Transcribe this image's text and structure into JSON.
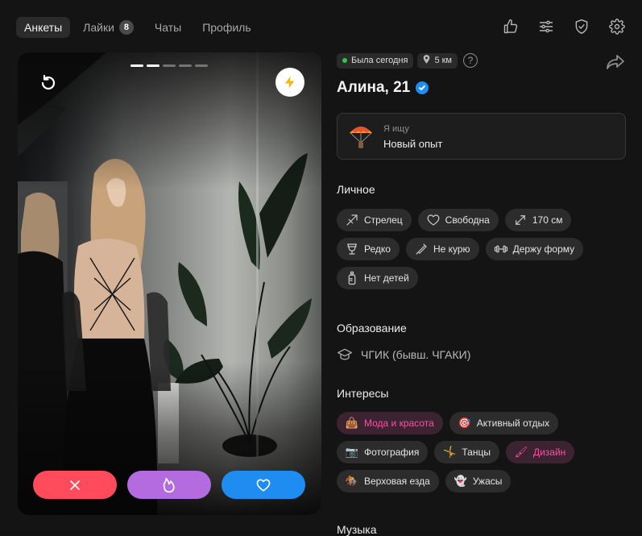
{
  "tabs": [
    {
      "label": "Анкеты",
      "active": true
    },
    {
      "label": "Лайки",
      "badge": "8"
    },
    {
      "label": "Чаты"
    },
    {
      "label": "Профиль"
    }
  ],
  "top_icons": [
    "thumbs-up-icon",
    "filters-icon",
    "shield-check-icon",
    "settings-icon"
  ],
  "photo": {
    "progress_total": 5,
    "progress_current": 2
  },
  "actions": {
    "dislike_color": "#ff4b5c",
    "super_color": "#b56be0",
    "like_color": "#1f8cf2"
  },
  "profile": {
    "status": "Была сегодня",
    "distance": "5 км",
    "help": "?",
    "name": "Алина, 21",
    "verified": true,
    "seeking_label": "Я ищу",
    "seeking_value": "Новый опыт"
  },
  "personal": {
    "title": "Личное",
    "chips": [
      {
        "label": "Стрелец",
        "icon": "sagittarius-icon"
      },
      {
        "label": "Свободна",
        "icon": "heart-outline-icon"
      },
      {
        "label": "170 см",
        "icon": "height-arrows-icon"
      },
      {
        "label": "Редко",
        "icon": "wine-glass-icon"
      },
      {
        "label": "Не курю",
        "icon": "no-smoking-icon"
      },
      {
        "label": "Держу форму",
        "icon": "dumbbell-icon"
      },
      {
        "label": "Нет детей",
        "icon": "baby-bottle-icon"
      }
    ]
  },
  "education": {
    "title": "Образование",
    "value": "ЧГИК (бывш. ЧГАКИ)"
  },
  "interests": {
    "title": "Интересы",
    "chips": [
      {
        "label": "Мода и красота",
        "emoji": "👜",
        "highlight": true
      },
      {
        "label": "Активный отдых",
        "emoji": "🎯",
        "highlight": false
      },
      {
        "label": "Фотография",
        "emoji": "📷",
        "highlight": false
      },
      {
        "label": "Танцы",
        "emoji": "🤸",
        "highlight": false
      },
      {
        "label": "Дизайн",
        "emoji": "🖌",
        "highlight": true
      },
      {
        "label": "Верховая езда",
        "emoji": "🏇",
        "highlight": false
      },
      {
        "label": "Ужасы",
        "emoji": "👻",
        "highlight": false
      }
    ]
  },
  "music": {
    "title": "Музыка"
  },
  "colors": {
    "background": "#141414",
    "chip": "#2c2c2c",
    "highlight_chip_text": "#ff4fa5",
    "verified": "#1e8ef4",
    "online_dot": "#36c24a"
  }
}
